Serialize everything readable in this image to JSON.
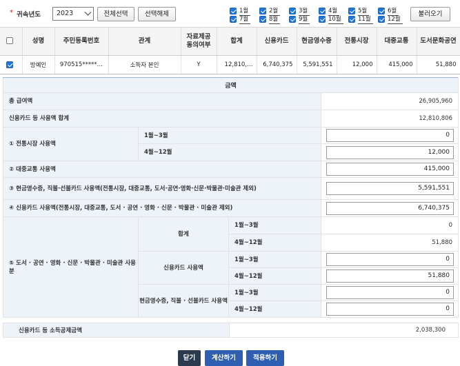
{
  "filter": {
    "required_mark": "*",
    "year_label": "귀속년도",
    "year_value": "2023",
    "select_all": "전체선택",
    "deselect": "선택해제",
    "load": "불러오기",
    "months": [
      {
        "label": "1월",
        "checked": true
      },
      {
        "label": "2월",
        "checked": true
      },
      {
        "label": "3월",
        "checked": true
      },
      {
        "label": "4월",
        "checked": true
      },
      {
        "label": "5월",
        "checked": true
      },
      {
        "label": "6월",
        "checked": true
      },
      {
        "label": "7월",
        "checked": true
      },
      {
        "label": "8월",
        "checked": true
      },
      {
        "label": "9월",
        "checked": true
      },
      {
        "label": "10월",
        "checked": true
      },
      {
        "label": "11월",
        "checked": true
      },
      {
        "label": "12월",
        "checked": true
      }
    ]
  },
  "person_table": {
    "headers": [
      "성명",
      "주민등록번호",
      "관계",
      "자료제공\n동의여부",
      "합계",
      "신용카드",
      "현금영수증",
      "전통시장",
      "대중교통",
      "도서문화공연"
    ],
    "row": {
      "checked": true,
      "name": "방예인",
      "id": "970515*****…",
      "relation": "소득자 본인",
      "consent": "Y",
      "total": "12,810,…",
      "credit": "6,740,375",
      "cash": "5,591,551",
      "market": "12,000",
      "transit": "415,000",
      "culture": "51,880"
    }
  },
  "amounts": {
    "header": "금액",
    "gross_label": "총 급여액",
    "gross_value": "26,905,960",
    "card_total_label": "신용카드 등 사용액 합계",
    "card_total_value": "12,810,806",
    "market_label": "① 전통시장 사용액",
    "market_p1_label": "1월~3월",
    "market_p1_value": "0",
    "market_p2_label": "4월~12월",
    "market_p2_value": "12,000",
    "transit_label": "② 대중교통 사용액",
    "transit_value": "415,000",
    "cash_label": "③ 현금영수증, 직불·선불카드 사용액(전통시장, 대중교통, 도서·공연·영화·신문·박물관·미술관 제외)",
    "cash_value": "5,591,551",
    "credit_label": "④ 신용카드 사용액(전통시장, 대중교통, 도서 · 공연 · 영화 · 신문 · 박물관 · 미술관 제외)",
    "credit_value": "6,740,375",
    "culture_label": "⑤ 도서 · 공연 · 영화 · 신문 · 박물관 · 미술관 사용분",
    "culture_total_label": "합계",
    "culture_total_p1_label": "1월~3월",
    "culture_total_p1_value": "0",
    "culture_total_p2_label": "4월~12월",
    "culture_total_p2_value": "51,880",
    "culture_credit_label": "신용카드 사용액",
    "culture_credit_p1_label": "1월~3월",
    "culture_credit_p1_value": "0",
    "culture_credit_p2_label": "4월~12월",
    "culture_credit_p2_value": "51,880",
    "culture_cash_label": "현금영수증, 직불 · 선불카드 사용액",
    "culture_cash_p1_label": "1월~3월",
    "culture_cash_p1_value": "0",
    "culture_cash_p2_label": "4월~12월",
    "culture_cash_p2_value": "0"
  },
  "summary": {
    "label": "신용카드 등 소득공제금액",
    "value": "2,038,300"
  },
  "footer": {
    "close": "닫기",
    "calculate": "계산하기",
    "apply": "적용하기"
  },
  "colors": {
    "checkbox_on": "#2176d8",
    "label_bg": "#eef3f9",
    "close_button": "#2c3a4f",
    "action_button": "#2f5fb3"
  }
}
